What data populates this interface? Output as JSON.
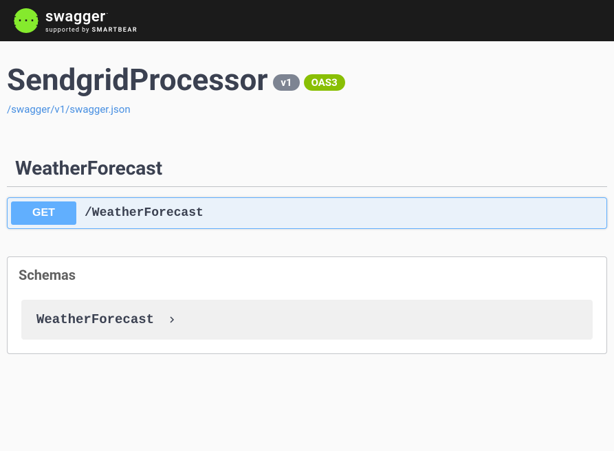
{
  "header": {
    "brand": "swagger",
    "supported_prefix": "supported by ",
    "supported_brand": "SMARTBEAR",
    "logo_glyph": "{···}"
  },
  "api": {
    "title": "SendgridProcessor",
    "version": "v1",
    "oas": "OAS3",
    "spec_link": "/swagger/v1/swagger.json"
  },
  "tag": {
    "name": "WeatherForecast",
    "operations": [
      {
        "method": "GET",
        "path": "/WeatherForecast"
      }
    ]
  },
  "schemas": {
    "title": "Schemas",
    "items": [
      {
        "name": "WeatherForecast"
      }
    ]
  }
}
